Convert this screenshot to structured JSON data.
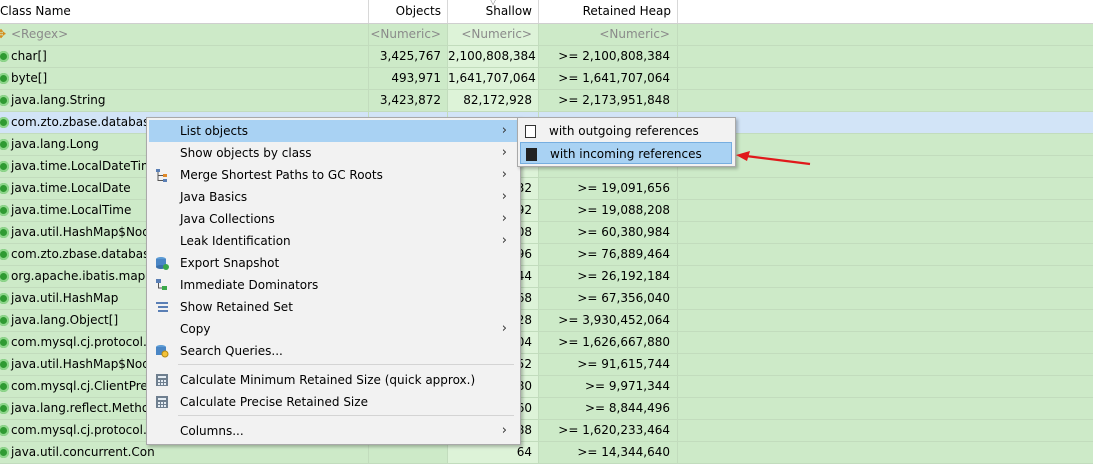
{
  "columns": {
    "class_name": "Class Name",
    "objects": "Objects",
    "shallow_heap": "Shallow Heap",
    "retained_heap": "Retained Heap"
  },
  "regex_row": {
    "name": "<Regex>",
    "objects": "<Numeric>",
    "shallow": "<Numeric>",
    "retained": "<Numeric>"
  },
  "rows": [
    {
      "name": "char[]",
      "objects": "3,425,767",
      "shallow": "2,100,808,384",
      "retained": ">= 2,100,808,384"
    },
    {
      "name": "byte[]",
      "objects": "493,971",
      "shallow": "1,641,707,064",
      "retained": ">= 1,641,707,064"
    },
    {
      "name": "java.lang.String",
      "objects": "3,423,872",
      "shallow": "82,172,928",
      "retained": ">= 2,173,951,848"
    },
    {
      "name": "com.zto.zbase.databas",
      "objects": "",
      "shallow": "",
      "retained": ""
    },
    {
      "name": "java.lang.Long",
      "objects": "",
      "shallow": "",
      "retained": ""
    },
    {
      "name": "java.time.LocalDateTim",
      "objects": "",
      "shallow": "",
      "retained": ""
    },
    {
      "name": "java.time.LocalDate",
      "objects": "",
      "shallow": "32",
      "retained": ">= 19,091,656"
    },
    {
      "name": "java.time.LocalTime",
      "objects": "",
      "shallow": "92",
      "retained": ">= 19,088,208"
    },
    {
      "name": "java.util.HashMap$Nod",
      "objects": "",
      "shallow": "08",
      "retained": ">= 60,380,984"
    },
    {
      "name": "com.zto.zbase.databas",
      "objects": "",
      "shallow": "96",
      "retained": ">= 76,889,464"
    },
    {
      "name": "org.apache.ibatis.mapp",
      "objects": "",
      "shallow": "44",
      "retained": ">= 26,192,184"
    },
    {
      "name": "java.util.HashMap",
      "objects": "",
      "shallow": "68",
      "retained": ">= 67,356,040"
    },
    {
      "name": "java.lang.Object[]",
      "objects": "",
      "shallow": "28",
      "retained": ">= 3,930,452,064"
    },
    {
      "name": "com.mysql.cj.protocol.a",
      "objects": "",
      "shallow": "04",
      "retained": ">= 1,626,667,880"
    },
    {
      "name": "java.util.HashMap$Nod",
      "objects": "",
      "shallow": "52",
      "retained": ">= 91,615,744"
    },
    {
      "name": "com.mysql.cj.ClientPrep",
      "objects": "",
      "shallow": "80",
      "retained": ">= 9,971,344"
    },
    {
      "name": "java.lang.reflect.Metho",
      "objects": "",
      "shallow": "60",
      "retained": ">= 8,844,496"
    },
    {
      "name": "com.mysql.cj.protocol.a",
      "objects": "",
      "shallow": "88",
      "retained": ">= 1,620,233,464"
    },
    {
      "name": "java.util.concurrent.Con",
      "objects": "",
      "shallow": "64",
      "retained": ">= 14,344,640"
    }
  ],
  "context_menu": {
    "items": [
      {
        "label": "List objects",
        "submenu": true
      },
      {
        "label": "Show objects by class",
        "submenu": true
      },
      {
        "label": "Merge Shortest Paths to GC Roots",
        "submenu": true
      },
      {
        "label": "Java Basics",
        "submenu": true
      },
      {
        "label": "Java Collections",
        "submenu": true
      },
      {
        "label": "Leak Identification",
        "submenu": true
      },
      {
        "label": "Export Snapshot",
        "submenu": false
      },
      {
        "label": "Immediate Dominators",
        "submenu": false
      },
      {
        "label": "Show Retained Set",
        "submenu": false
      },
      {
        "label": "Copy",
        "submenu": true
      },
      {
        "label": "Search Queries...",
        "submenu": false
      },
      {
        "label": "Calculate Minimum Retained Size (quick approx.)",
        "submenu": false
      },
      {
        "label": "Calculate Precise Retained Size",
        "submenu": false
      },
      {
        "label": "Columns...",
        "submenu": true
      }
    ]
  },
  "submenu": {
    "items": [
      {
        "label": "with outgoing references"
      },
      {
        "label": "with incoming references"
      }
    ]
  },
  "colors": {
    "row_bg": "#cdeac8",
    "highlight": "#a9d2f3",
    "arrow": "#e0191b"
  }
}
